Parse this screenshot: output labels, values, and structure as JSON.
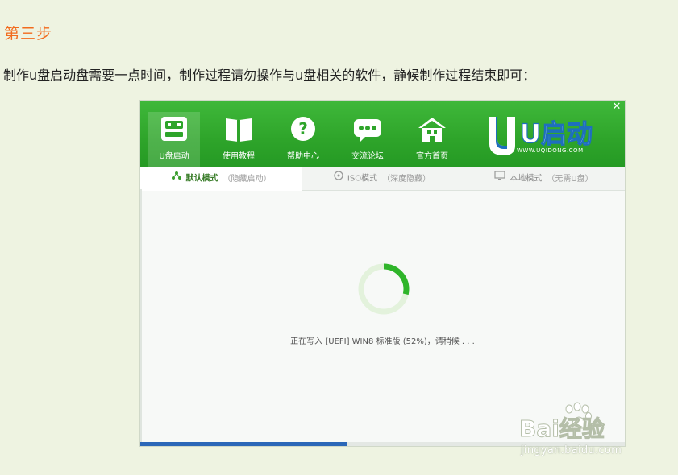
{
  "heading": "第三步",
  "description": "制作u盘启动盘需要一点时间，制作过程请勿操作与u盘相关的软件，静候制作过程结束即可：",
  "window": {
    "close_glyph": "✕",
    "nav": [
      {
        "label": "U盘启动",
        "icon": "usb-drive-icon",
        "active": true
      },
      {
        "label": "使用教程",
        "icon": "book-icon",
        "active": false
      },
      {
        "label": "帮助中心",
        "icon": "question-icon",
        "active": false
      },
      {
        "label": "交流论坛",
        "icon": "chat-bubble-icon",
        "active": false
      },
      {
        "label": "官方首页",
        "icon": "house-icon",
        "active": false
      }
    ],
    "logo": {
      "text": "U启动",
      "url": "WWW.UQIDONG.COM"
    },
    "tabs": [
      {
        "label": "默认模式",
        "hint": "（隐藏启动）",
        "icon": "share-nodes-icon",
        "active": true
      },
      {
        "label": "ISO模式",
        "hint": "（深度隐藏）",
        "icon": "disc-icon",
        "active": false
      },
      {
        "label": "本地模式",
        "hint": "（无需U盘）",
        "icon": "monitor-icon",
        "active": false
      }
    ],
    "progress": {
      "percent": 52
    },
    "status_text": "正在写入 [UEFI] WIN8 标准版 (52%)，请稍候 . . ."
  },
  "watermark": {
    "brand": "Bai经验",
    "url": "jingyan.baidu.com"
  },
  "colors": {
    "green": "#2ea42a",
    "orange": "#f26b1d",
    "page_bg": "#eef3e1",
    "taskbar_blue": "#2b67b8"
  }
}
